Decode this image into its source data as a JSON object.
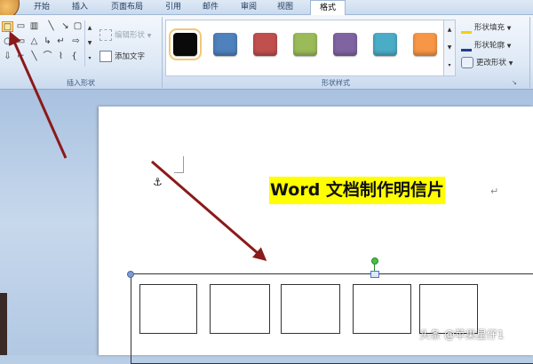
{
  "tabs": [
    {
      "label": "开始"
    },
    {
      "label": "插入"
    },
    {
      "label": "页面布局"
    },
    {
      "label": "引用"
    },
    {
      "label": "邮件"
    },
    {
      "label": "审阅"
    },
    {
      "label": "视图"
    },
    {
      "label": "格式"
    }
  ],
  "insert_shapes": {
    "group_label": "插入形状",
    "edit_shape_label": "编辑形状",
    "add_text_label": "添加文字",
    "shapes": [
      "□",
      "▭",
      "▥",
      "╲",
      "↘",
      "▢",
      "○",
      "▭",
      "△",
      "↳",
      "↵",
      "⇨",
      "⇩",
      "⌐",
      "╲",
      "⌒",
      "⌇",
      "{",
      "☆"
    ]
  },
  "shape_styles": {
    "group_label": "形状样式",
    "swatches": [
      {
        "name": "black",
        "color": "#0a0a0a"
      },
      {
        "name": "blue",
        "color": "#4f81bd"
      },
      {
        "name": "red",
        "color": "#c0504d"
      },
      {
        "name": "green",
        "color": "#9bbb59"
      },
      {
        "name": "purple",
        "color": "#8064a2"
      },
      {
        "name": "aqua",
        "color": "#4bacc6"
      },
      {
        "name": "orange",
        "color": "#f79646"
      }
    ],
    "fill_label": "形状填充",
    "outline_label": "形状轮廓",
    "change_label": "更改形状"
  },
  "document": {
    "title": "Word 文档制作明信片",
    "paragraph_mark": "↵",
    "anchor_symbol": "⚓"
  },
  "watermark": "头条 @苹果星仔1",
  "colors": {
    "arrow": "#8b1a1a",
    "highlight": "#ffff00"
  }
}
